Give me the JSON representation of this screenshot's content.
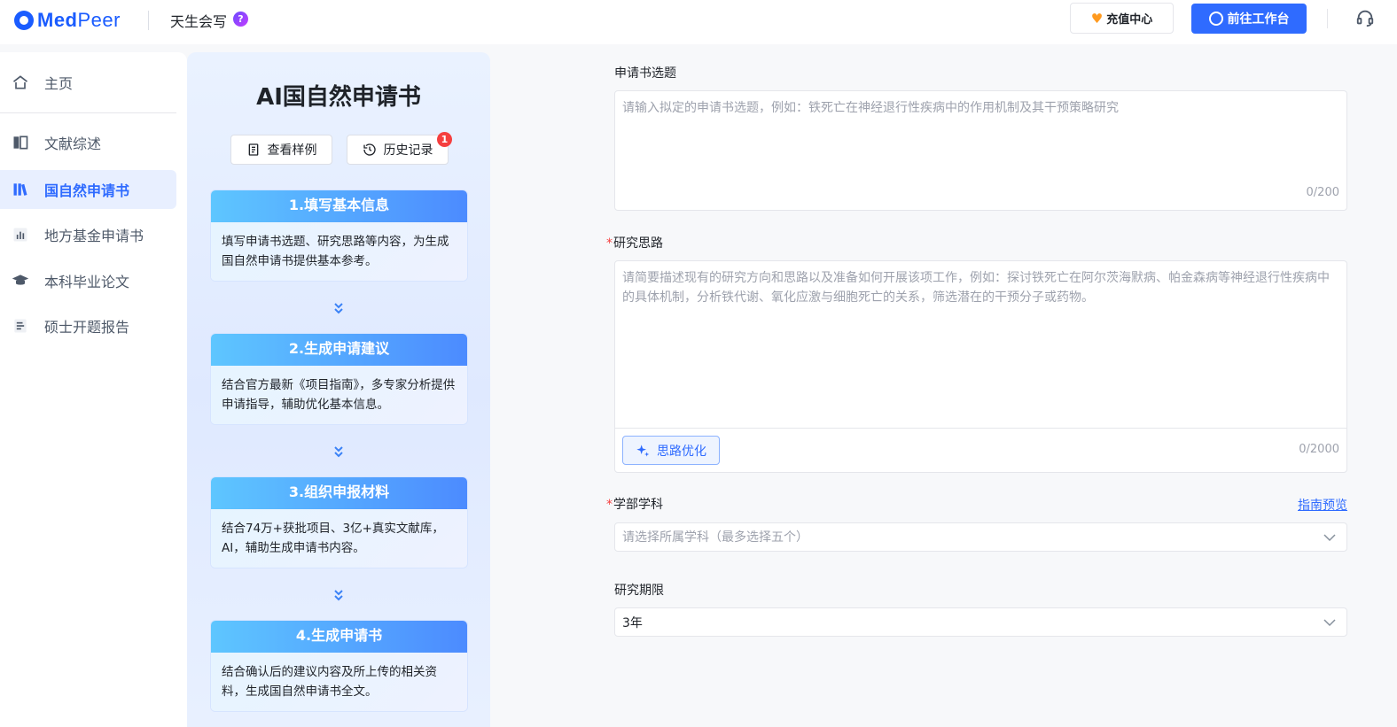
{
  "header": {
    "logo_bold": "Med",
    "logo_light": "Peer",
    "app_name": "天生会写",
    "help_glyph": "?",
    "recharge_label": "充值中心",
    "workbench_label": "前往工作台"
  },
  "sidebar": {
    "items": [
      {
        "label": "主页",
        "icon": "home-icon"
      },
      {
        "label": "文献综述",
        "icon": "book-icon"
      },
      {
        "label": "国自然申请书",
        "icon": "library-icon"
      },
      {
        "label": "地方基金申请书",
        "icon": "chart-icon"
      },
      {
        "label": "本科毕业论文",
        "icon": "graduation-cap-icon"
      },
      {
        "label": "硕士开题报告",
        "icon": "report-icon"
      }
    ],
    "active_index": 2
  },
  "steps_panel": {
    "title": "AI国自然申请书",
    "sample_label": "查看样例",
    "history_label": "历史记录",
    "history_badge": "1",
    "steps": [
      {
        "title": "1.填写基本信息",
        "desc": "填写申请书选题、研究思路等内容，为生成国自然申请书提供基本参考。"
      },
      {
        "title": "2.生成申请建议",
        "desc": "结合官方最新《项目指南》，多专家分析提供申请指导，辅助优化基本信息。"
      },
      {
        "title": "3.组织申报材料",
        "desc": "结合74万+获批项目、3亿+真实文献库，AI，辅助生成申请书内容。"
      },
      {
        "title": "4.生成申请书",
        "desc": "结合确认后的建议内容及所上传的相关资料，生成国自然申请书全文。"
      }
    ]
  },
  "form": {
    "topic": {
      "label": "申请书选题",
      "placeholder": "请输入拟定的申请书选题，例如：铁死亡在神经退行性疾病中的作用机制及其干预策略研究",
      "counter": "0/200"
    },
    "idea": {
      "label": "研究思路",
      "required_mark": "*",
      "placeholder": "请简要描述现有的研究方向和思路以及准备如何开展该项工作，例如：探讨铁死亡在阿尔茨海默病、帕金森病等神经退行性疾病中的具体机制，分析铁代谢、氧化应激与细胞死亡的关系，筛选潜在的干预分子或药物。",
      "optimize_label": "思路优化",
      "counter": "0/2000"
    },
    "discipline": {
      "label": "学部学科",
      "required_mark": "*",
      "guide_link": "指南预览",
      "placeholder": "请选择所属学科（最多选择五个）"
    },
    "period": {
      "label": "研究期限",
      "value": "3年"
    }
  },
  "colors": {
    "accent": "#2f6bff",
    "active_bg": "#e8efff",
    "step_gradient_start": "#5ec6ff",
    "step_gradient_end": "#4c8bff",
    "required": "#f53f3f"
  }
}
